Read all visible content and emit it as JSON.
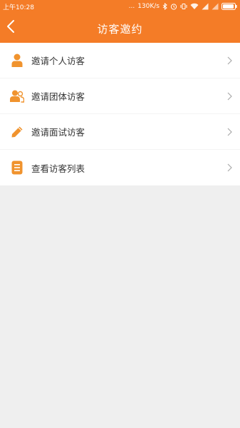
{
  "status_bar": {
    "time": "上午10:28",
    "dots": "...",
    "speed": "130K/s"
  },
  "header": {
    "title": "访客邀约"
  },
  "menu": {
    "items": [
      {
        "label": "邀请个人访客",
        "icon": "person-icon"
      },
      {
        "label": "邀请团体访客",
        "icon": "group-icon"
      },
      {
        "label": "邀请面试访客",
        "icon": "pencil-icon"
      },
      {
        "label": "查看访客列表",
        "icon": "list-icon"
      }
    ]
  },
  "colors": {
    "brand": "#f47c27",
    "background": "#efefef"
  }
}
